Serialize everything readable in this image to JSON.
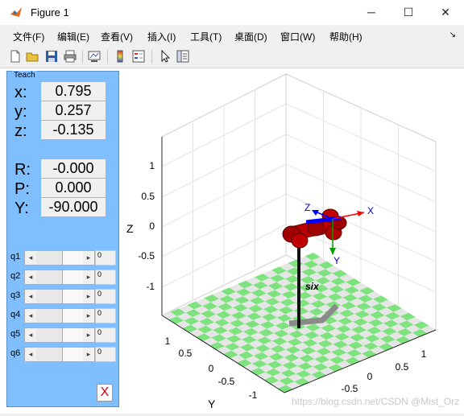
{
  "window": {
    "title": "Figure 1"
  },
  "menu": [
    "文件(F)",
    "编辑(E)",
    "查看(V)",
    "插入(I)",
    "工具(T)",
    "桌面(D)",
    "窗口(W)",
    "帮助(H)"
  ],
  "toolbar": [
    "new-figure",
    "open-file",
    "save",
    "print",
    "link-plot",
    "insert-colorbar",
    "insert-legend",
    "edit-plot",
    "property-inspector"
  ],
  "teach": {
    "title": "Teach",
    "x_label": "x:",
    "x_value": "0.795",
    "y_label": "y:",
    "y_value": "0.257",
    "z_label": "z:",
    "z_value": "-0.135",
    "r_label": "R:",
    "r_value": "-0.000",
    "p_label": "P:",
    "p_value": "0.000",
    "yaw_label": "Y:",
    "yaw_value": "-90.000",
    "joints": [
      {
        "label": "q1",
        "value": "0"
      },
      {
        "label": "q2",
        "value": "0"
      },
      {
        "label": "q3",
        "value": "0"
      },
      {
        "label": "q4",
        "value": "0"
      },
      {
        "label": "q5",
        "value": "0"
      },
      {
        "label": "q6",
        "value": "0"
      }
    ],
    "close_label": "X"
  },
  "plot": {
    "zlabel": "Z",
    "ylabel": "Y",
    "robot_name": "six",
    "z_ticks": [
      "1",
      "0.5",
      "0",
      "-0.5",
      "-1"
    ],
    "y_ticks": [
      "1",
      "0.5",
      "0",
      "-0.5",
      "-1"
    ],
    "x_ticks": [
      "-0.5",
      "0",
      "0.5",
      "1"
    ],
    "frame_x": "X",
    "frame_y": "Y",
    "frame_z": "Z",
    "floor_color": "#7ee27e"
  },
  "watermark": "https://blog.csdn.net/CSDN @Mist_Orz"
}
